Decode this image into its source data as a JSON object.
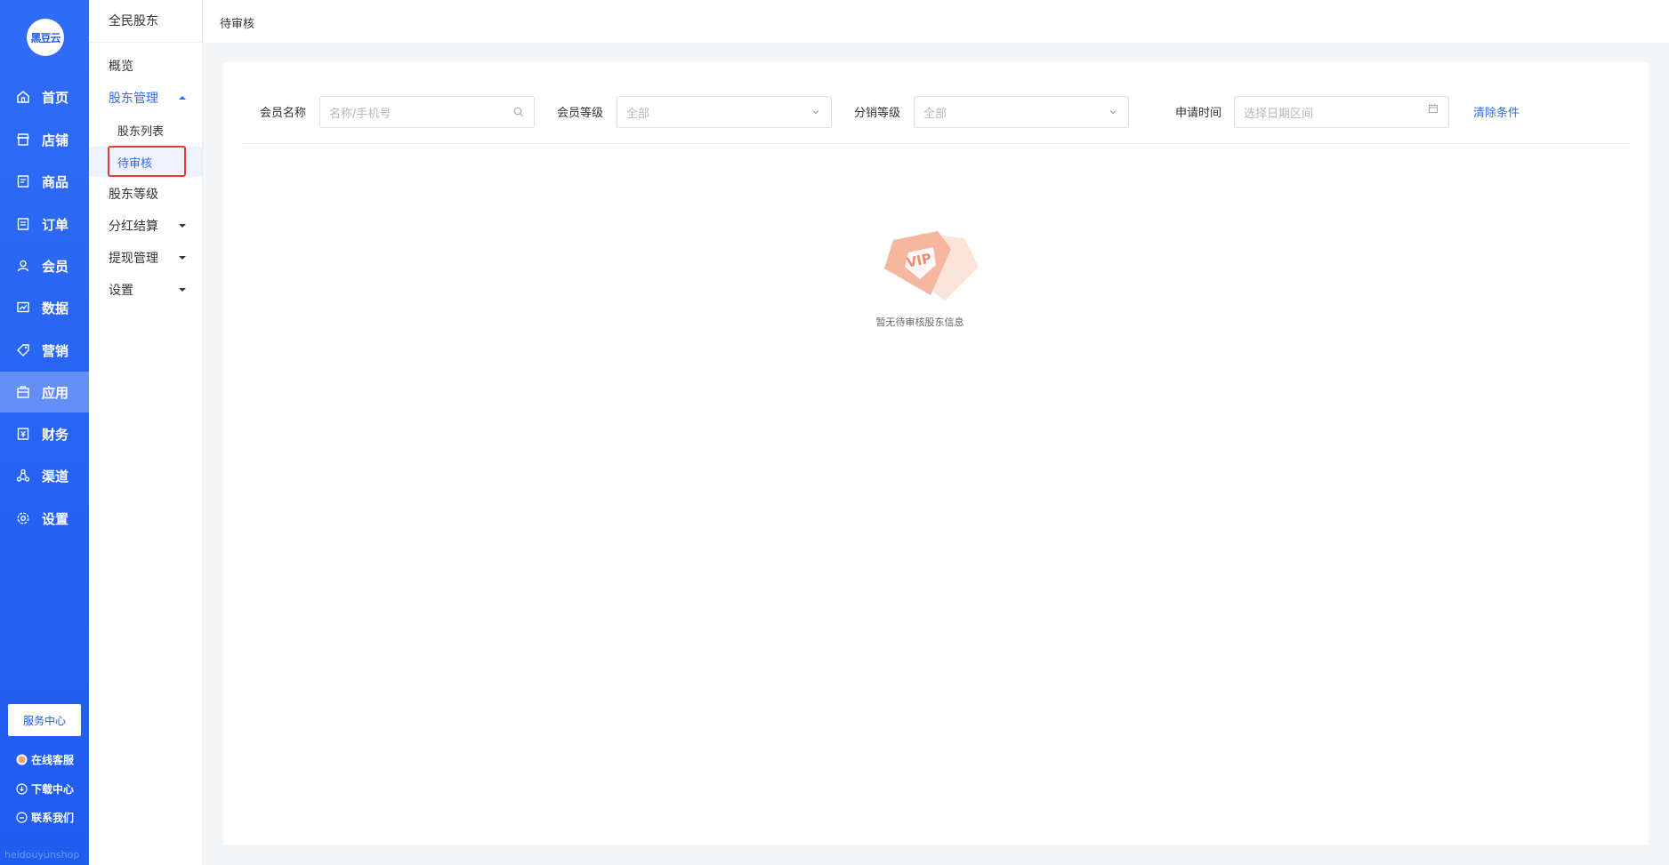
{
  "app": {
    "logo_text": "黑豆云",
    "watermark": "heidouyunshop"
  },
  "primary_nav": [
    {
      "label": "首页",
      "icon": "home-icon"
    },
    {
      "label": "店铺",
      "icon": "store-icon"
    },
    {
      "label": "商品",
      "icon": "product-icon"
    },
    {
      "label": "订单",
      "icon": "order-icon"
    },
    {
      "label": "会员",
      "icon": "member-icon"
    },
    {
      "label": "数据",
      "icon": "chart-icon"
    },
    {
      "label": "营销",
      "icon": "tag-icon"
    },
    {
      "label": "应用",
      "icon": "app-icon",
      "active": true
    },
    {
      "label": "财务",
      "icon": "finance-icon"
    },
    {
      "label": "渠道",
      "icon": "channel-icon"
    },
    {
      "label": "设置",
      "icon": "gear-icon"
    }
  ],
  "service_center": "服务中心",
  "aux_links": [
    {
      "label": "在线客服",
      "icon": "avatar-icon"
    },
    {
      "label": "下载中心",
      "icon": "download-icon"
    },
    {
      "label": "联系我们",
      "icon": "chat-icon"
    }
  ],
  "subnav": {
    "title": "全民股东",
    "items": [
      {
        "label": "概览"
      },
      {
        "label": "股东管理",
        "expanded": true
      },
      {
        "label": "股东列表",
        "child": true
      },
      {
        "label": "待审核",
        "child": true,
        "selected": true
      },
      {
        "label": "股东等级"
      },
      {
        "label": "分红结算"
      },
      {
        "label": "提现管理"
      },
      {
        "label": "设置"
      }
    ]
  },
  "header": {
    "breadcrumb": "待审核"
  },
  "filters": {
    "member_name_label": "会员名称",
    "member_name_placeholder": "名称/手机号",
    "member_level_label": "会员等级",
    "member_level_value": "全部",
    "dist_level_label": "分销等级",
    "dist_level_value": "全部",
    "apply_time_label": "申请时间",
    "apply_time_placeholder": "选择日期区间",
    "clear_label": "清除条件"
  },
  "empty_state": {
    "badge_text": "VIP",
    "message": "暂无待审核股东信息"
  },
  "colors": {
    "primary": "#2f6cf6",
    "highlight": "#e53935",
    "vip": "#f7a58a"
  }
}
